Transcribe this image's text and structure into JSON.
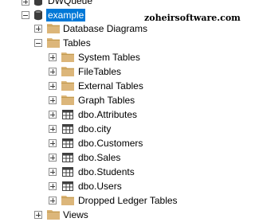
{
  "tree": {
    "top_partial_label": "DWQueue",
    "db_label": "example",
    "db_diagrams_label": "Database Diagrams",
    "tables_label": "Tables",
    "children": [
      "System Tables",
      "FileTables",
      "External Tables",
      "Graph Tables",
      "dbo.Attributes",
      "dbo.city",
      "dbo.Customers",
      "dbo.Sales",
      "dbo.Students",
      "dbo.Users",
      "Dropped Ledger Tables"
    ],
    "bottom_partial_label": "Views"
  },
  "watermark": "zoheirsoftware.com",
  "colors": {
    "selection": "#0078d7",
    "folder": "#dcb67a",
    "folder_dark": "#c19a4f",
    "table_icon": "#404040",
    "db_icon": "#3c3c3c"
  }
}
